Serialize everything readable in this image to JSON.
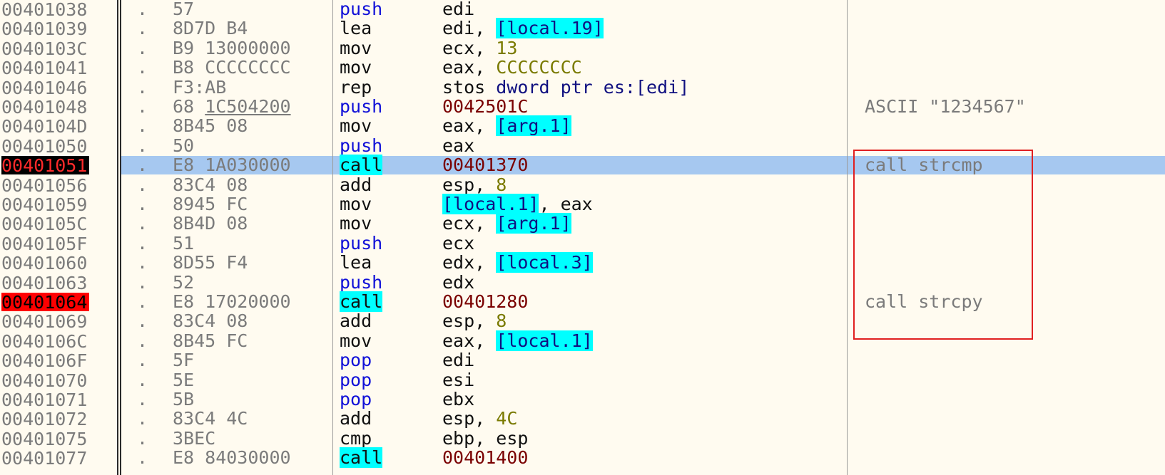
{
  "rows": [
    {
      "addr": "00401038",
      "dot": ".",
      "hex": "57",
      "hex_ul": "",
      "mnem": "push",
      "ops": [
        {
          "t": "edi",
          "c": "c-black"
        }
      ],
      "comment": "",
      "bp": ""
    },
    {
      "addr": "00401039",
      "dot": ".",
      "hex": "8D7D B4",
      "hex_ul": "",
      "mnem": "lea",
      "ops": [
        {
          "t": "edi",
          "c": "c-black"
        },
        {
          "t": ", ",
          "c": "c-black"
        },
        {
          "t": "[local.19]",
          "c": "hl-cyan c-cyanbox"
        }
      ],
      "comment": "",
      "bp": ""
    },
    {
      "addr": "0040103C",
      "dot": ".",
      "hex": "B9 13000000",
      "hex_ul": "",
      "mnem": "mov",
      "ops": [
        {
          "t": "ecx",
          "c": "c-black"
        },
        {
          "t": ", ",
          "c": "c-black"
        },
        {
          "t": "13",
          "c": "c-olive"
        }
      ],
      "comment": "",
      "bp": ""
    },
    {
      "addr": "00401041",
      "dot": ".",
      "hex": "B8 CCCCCCCC",
      "hex_ul": "",
      "mnem": "mov",
      "ops": [
        {
          "t": "eax",
          "c": "c-black"
        },
        {
          "t": ", ",
          "c": "c-black"
        },
        {
          "t": "CCCCCCCC",
          "c": "c-olive"
        }
      ],
      "comment": "",
      "bp": ""
    },
    {
      "addr": "00401046",
      "dot": ".",
      "hex": "F3:AB",
      "hex_ul": "",
      "mnem": "rep",
      "ops": [
        {
          "t": "stos ",
          "c": "c-black"
        },
        {
          "t": "dword ptr es:[edi]",
          "c": "c-navy"
        }
      ],
      "comment": "",
      "bp": ""
    },
    {
      "addr": "00401048",
      "dot": ".",
      "hex": "68 ",
      "hex_ul": "1C504200",
      "mnem": "push",
      "ops": [
        {
          "t": "0042501C",
          "c": "c-maroon"
        }
      ],
      "comment": "ASCII \"1234567\"",
      "bp": ""
    },
    {
      "addr": "0040104D",
      "dot": ".",
      "hex": "8B45 08",
      "hex_ul": "",
      "mnem": "mov",
      "ops": [
        {
          "t": "eax",
          "c": "c-black"
        },
        {
          "t": ", ",
          "c": "c-black"
        },
        {
          "t": "[arg.1]",
          "c": "hl-cyan c-cyanbox"
        }
      ],
      "comment": "",
      "bp": ""
    },
    {
      "addr": "00401050",
      "dot": ".",
      "hex": "50",
      "hex_ul": "",
      "mnem": "push",
      "ops": [
        {
          "t": "eax",
          "c": "c-black"
        }
      ],
      "comment": "",
      "bp": ""
    },
    {
      "addr": "00401051",
      "dot": ".",
      "hex": "E8 1A030000",
      "hex_ul": "",
      "mnem": "call",
      "ops": [
        {
          "t": "00401370",
          "c": "c-maroon"
        }
      ],
      "comment": "call strcmp",
      "bp": "bp-black",
      "selected": true
    },
    {
      "addr": "00401056",
      "dot": ".",
      "hex": "83C4 08",
      "hex_ul": "",
      "mnem": "add",
      "ops": [
        {
          "t": "esp",
          "c": "c-black"
        },
        {
          "t": ", ",
          "c": "c-black"
        },
        {
          "t": "8",
          "c": "c-olive"
        }
      ],
      "comment": "",
      "bp": ""
    },
    {
      "addr": "00401059",
      "dot": ".",
      "hex": "8945 FC",
      "hex_ul": "",
      "mnem": "mov",
      "ops": [
        {
          "t": "[local.1]",
          "c": "hl-cyan c-cyanbox"
        },
        {
          "t": ", ",
          "c": "c-black"
        },
        {
          "t": "eax",
          "c": "c-black"
        }
      ],
      "comment": "",
      "bp": ""
    },
    {
      "addr": "0040105C",
      "dot": ".",
      "hex": "8B4D 08",
      "hex_ul": "",
      "mnem": "mov",
      "ops": [
        {
          "t": "ecx",
          "c": "c-black"
        },
        {
          "t": ", ",
          "c": "c-black"
        },
        {
          "t": "[arg.1]",
          "c": "hl-cyan c-cyanbox"
        }
      ],
      "comment": "",
      "bp": ""
    },
    {
      "addr": "0040105F",
      "dot": ".",
      "hex": "51",
      "hex_ul": "",
      "mnem": "push",
      "ops": [
        {
          "t": "ecx",
          "c": "c-black"
        }
      ],
      "comment": "",
      "bp": ""
    },
    {
      "addr": "00401060",
      "dot": ".",
      "hex": "8D55 F4",
      "hex_ul": "",
      "mnem": "lea",
      "ops": [
        {
          "t": "edx",
          "c": "c-black"
        },
        {
          "t": ", ",
          "c": "c-black"
        },
        {
          "t": "[local.3]",
          "c": "hl-cyan c-cyanbox"
        }
      ],
      "comment": "",
      "bp": ""
    },
    {
      "addr": "00401063",
      "dot": ".",
      "hex": "52",
      "hex_ul": "",
      "mnem": "push",
      "ops": [
        {
          "t": "edx",
          "c": "c-black"
        }
      ],
      "comment": "",
      "bp": ""
    },
    {
      "addr": "00401064",
      "dot": ".",
      "hex": "E8 17020000",
      "hex_ul": "",
      "mnem": "call",
      "ops": [
        {
          "t": "00401280",
          "c": "c-maroon"
        }
      ],
      "comment": "call strcpy",
      "bp": "bp-red"
    },
    {
      "addr": "00401069",
      "dot": ".",
      "hex": "83C4 08",
      "hex_ul": "",
      "mnem": "add",
      "ops": [
        {
          "t": "esp",
          "c": "c-black"
        },
        {
          "t": ", ",
          "c": "c-black"
        },
        {
          "t": "8",
          "c": "c-olive"
        }
      ],
      "comment": "",
      "bp": ""
    },
    {
      "addr": "0040106C",
      "dot": ".",
      "hex": "8B45 FC",
      "hex_ul": "",
      "mnem": "mov",
      "ops": [
        {
          "t": "eax",
          "c": "c-black"
        },
        {
          "t": ", ",
          "c": "c-black"
        },
        {
          "t": "[local.1]",
          "c": "hl-cyan c-cyanbox"
        }
      ],
      "comment": "",
      "bp": ""
    },
    {
      "addr": "0040106F",
      "dot": ".",
      "hex": "5F",
      "hex_ul": "",
      "mnem": "pop",
      "ops": [
        {
          "t": "edi",
          "c": "c-black"
        }
      ],
      "comment": "",
      "bp": ""
    },
    {
      "addr": "00401070",
      "dot": ".",
      "hex": "5E",
      "hex_ul": "",
      "mnem": "pop",
      "ops": [
        {
          "t": "esi",
          "c": "c-black"
        }
      ],
      "comment": "",
      "bp": ""
    },
    {
      "addr": "00401071",
      "dot": ".",
      "hex": "5B",
      "hex_ul": "",
      "mnem": "pop",
      "ops": [
        {
          "t": "ebx",
          "c": "c-black"
        }
      ],
      "comment": "",
      "bp": ""
    },
    {
      "addr": "00401072",
      "dot": ".",
      "hex": "83C4 4C",
      "hex_ul": "",
      "mnem": "add",
      "ops": [
        {
          "t": "esp",
          "c": "c-black"
        },
        {
          "t": ", ",
          "c": "c-black"
        },
        {
          "t": "4C",
          "c": "c-olive"
        }
      ],
      "comment": "",
      "bp": ""
    },
    {
      "addr": "00401075",
      "dot": ".",
      "hex": "3BEC",
      "hex_ul": "",
      "mnem": "cmp",
      "ops": [
        {
          "t": "ebp",
          "c": "c-black"
        },
        {
          "t": ", ",
          "c": "c-black"
        },
        {
          "t": "esp",
          "c": "c-black"
        }
      ],
      "comment": "",
      "bp": ""
    },
    {
      "addr": "00401077",
      "dot": ".",
      "hex": "E8 84030000",
      "hex_ul": "",
      "mnem": "call",
      "ops": [
        {
          "t": "00401400",
          "c": "c-maroon"
        }
      ],
      "comment": "",
      "bp": ""
    }
  ],
  "colors": {
    "background": "#fffbf0",
    "selection": "#a6c8f0",
    "operand_highlight": "#00ffff",
    "breakpoint_red": "#ff0000",
    "annotation_box": "#e02020"
  }
}
